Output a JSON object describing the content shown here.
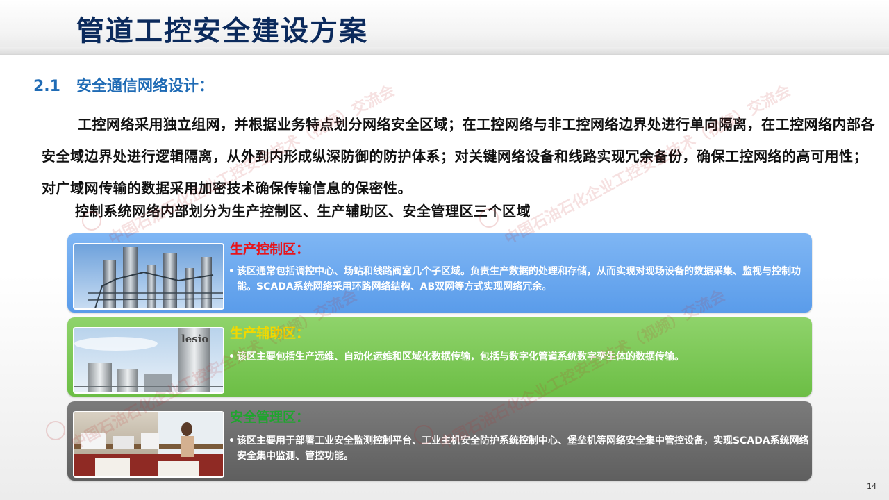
{
  "page": {
    "title": "管道工控安全建设方案",
    "page_number": "14"
  },
  "section": {
    "number": "2.1",
    "heading": "安全通信网络设计："
  },
  "paragraph": "工控网络采用独立组网，并根据业务特点划分网络安全区域；在工控网络与非工控网络边界处进行单向隔离，在工控网络内部各安全域边界处进行逻辑隔离，从外到内形成纵深防御的防护体系；对关键网络设备和线路实现冗余备份，确保工控网络的高可用性；对广域网传输的数据采用加密技术确保传输信息的保密性。",
  "zones_intro": "控制系统网络内部划分为生产控制区、生产辅助区、安全管理区三个区域",
  "zones": [
    {
      "title": "生产控制区：",
      "bullet": "•",
      "body": "该区通常包括调控中心、场站和线路阀室几个子区域。负责生产数据的处理和存储，从而实现对现场设备的数据采集、监视与控制功能。SCADA系统网络采用环路网络结构、AB双网等方式实现网络冗余。",
      "photo": "refinery-towers-photo"
    },
    {
      "title": "生产辅助区：",
      "bullet": "•",
      "body": "该区主要包括生产远维、自动化运维和区域化数据传输，包括与数字化管道系统数字孪生体的数据传输。",
      "photo": "industrial-tanks-photo",
      "photo_text": "lesio"
    },
    {
      "title": "安全管理区：",
      "bullet": "•",
      "body": "该区主要用于部署工业安全监测控制平台、工业主机安全防护系统控制中心、堡垒机等网络安全集中管控设备，实现SCADA系统网络安全集中监测、管控功能。",
      "photo": "office-workspace-photo"
    }
  ],
  "watermark": {
    "text": "中国石油石化企业工控安全技术（视频）交流会"
  },
  "colors": {
    "title": "#0b2a5c",
    "section_heading": "#1f6bb5",
    "zone1_bg": "#6aa8ef",
    "zone2_bg": "#7cc957",
    "zone3_bg": "#6b6b6b",
    "zone1_title": "#e8141b",
    "zone2_title": "#f2d800",
    "zone3_title": "#1fa52e"
  }
}
